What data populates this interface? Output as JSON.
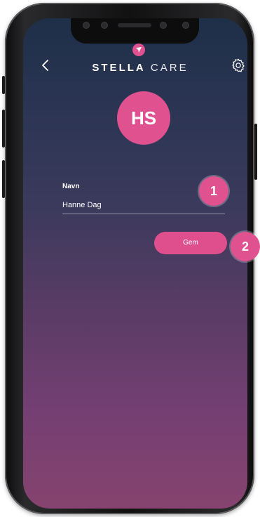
{
  "header": {
    "logo_text_bold": "STELLA",
    "logo_text_light": "CARE",
    "back_icon": "chevron-left-icon",
    "settings_icon": "gear-icon"
  },
  "profile": {
    "avatar_initials": "HS"
  },
  "form": {
    "name_label": "Navn",
    "name_value": "Hanne Dag",
    "save_label": "Gem"
  },
  "step_markers": [
    "1",
    "2"
  ],
  "colors": {
    "accent": "#e0518f",
    "background_top": "#1e2f48",
    "background_bottom": "#86436f",
    "text": "#ffffff"
  }
}
